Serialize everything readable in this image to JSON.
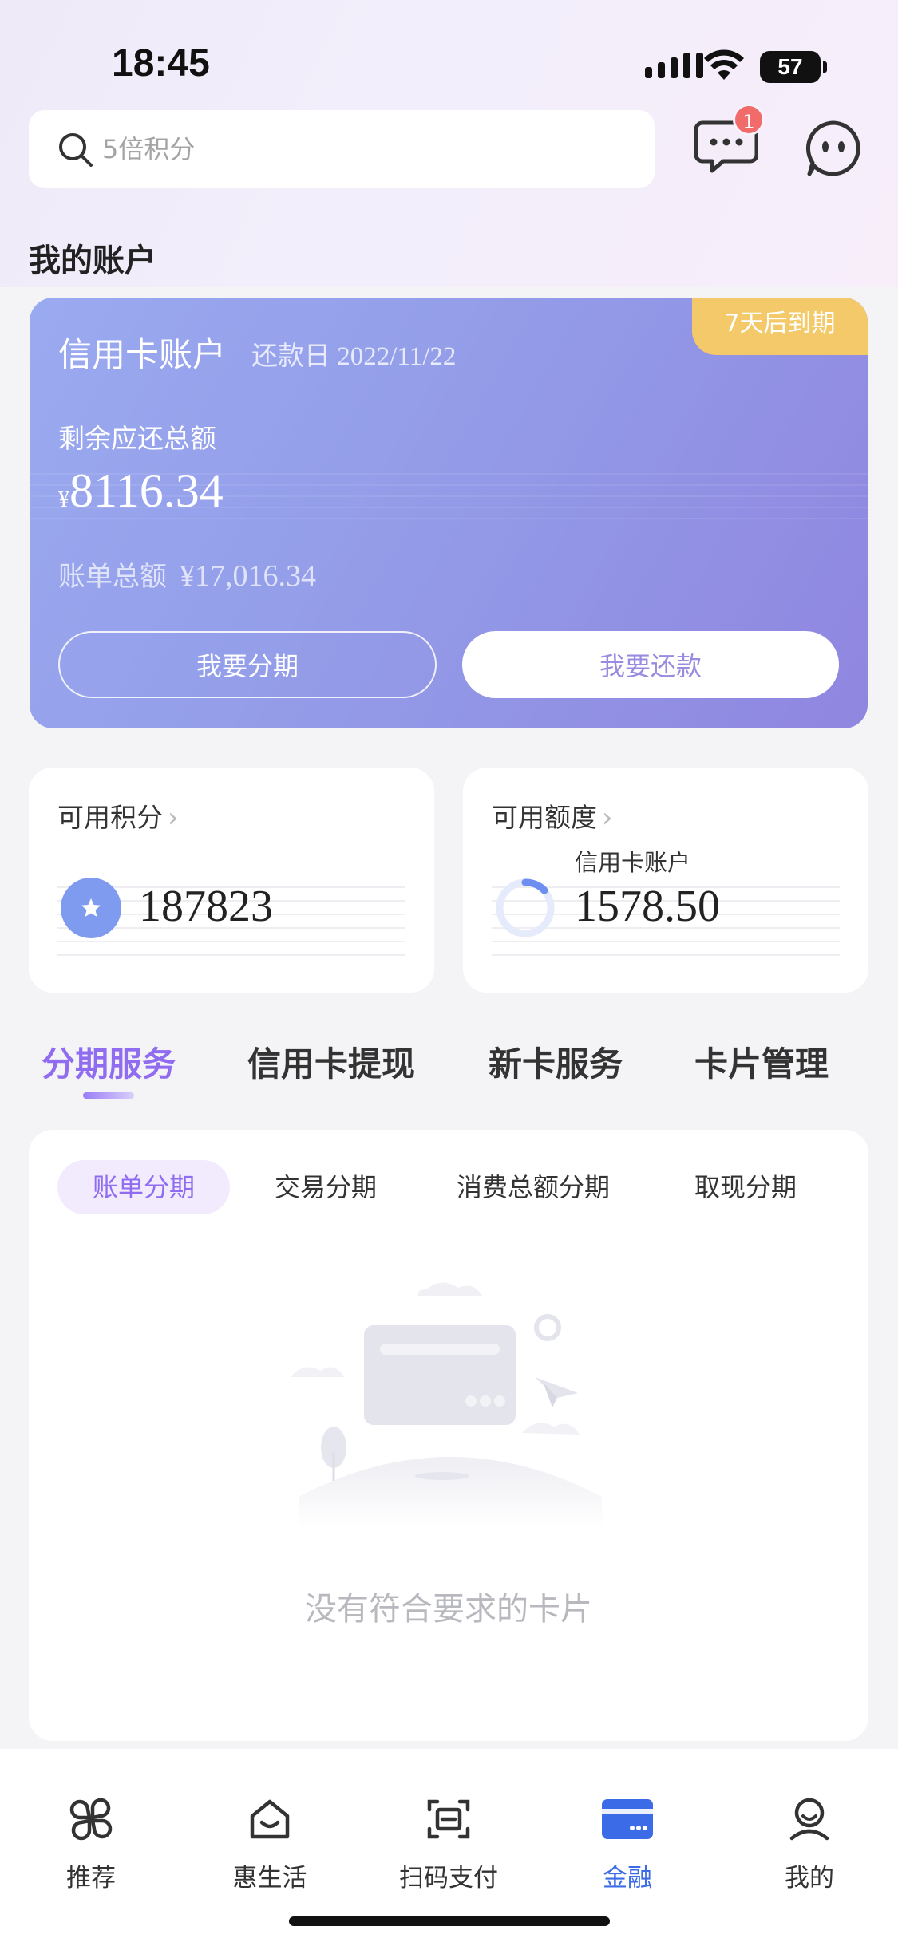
{
  "status_bar": {
    "time": "18:45",
    "battery": "57"
  },
  "search": {
    "placeholder": "5倍积分"
  },
  "header": {
    "message_badge": "1"
  },
  "section_title": "我的账户",
  "credit_card": {
    "name": "信用卡账户",
    "due_label": "还款日",
    "due_date": "2022/11/22",
    "due_tag": "7天后到期",
    "remaining_label": "剩余应还总额",
    "currency": "¥",
    "remaining_amount": "8116.34",
    "bill_total_label": "账单总额",
    "bill_total_value": "¥17,016.34",
    "installment_button": "我要分期",
    "repay_button": "我要还款",
    "colors": {
      "gradient_start": "#9aaaf0",
      "gradient_end": "#8f86e0",
      "tag": "#f3c96a"
    }
  },
  "points_card": {
    "title": "可用积分",
    "value": "187823"
  },
  "limit_card": {
    "title": "可用额度",
    "account": "信用卡账户",
    "value": "1578.50"
  },
  "main_tabs": [
    {
      "label": "分期服务",
      "active": true
    },
    {
      "label": "信用卡提现",
      "active": false
    },
    {
      "label": "新卡服务",
      "active": false
    },
    {
      "label": "卡片管理",
      "active": false
    }
  ],
  "sub_tabs": [
    {
      "label": "账单分期",
      "active": true
    },
    {
      "label": "交易分期",
      "active": false
    },
    {
      "label": "消费总额分期",
      "active": false
    },
    {
      "label": "取现分期",
      "active": false
    }
  ],
  "empty_state": {
    "text": "没有符合要求的卡片"
  },
  "bottom_nav": [
    {
      "label": "推荐",
      "icon": "grid-icon",
      "active": false
    },
    {
      "label": "惠生活",
      "icon": "house-smile-icon",
      "active": false
    },
    {
      "label": "扫码支付",
      "icon": "scan-icon",
      "active": false
    },
    {
      "label": "金融",
      "icon": "card-icon",
      "active": true
    },
    {
      "label": "我的",
      "icon": "person-icon",
      "active": false
    }
  ],
  "accent_color": "#8f6cf0",
  "nav_active_color": "#3b6be6"
}
